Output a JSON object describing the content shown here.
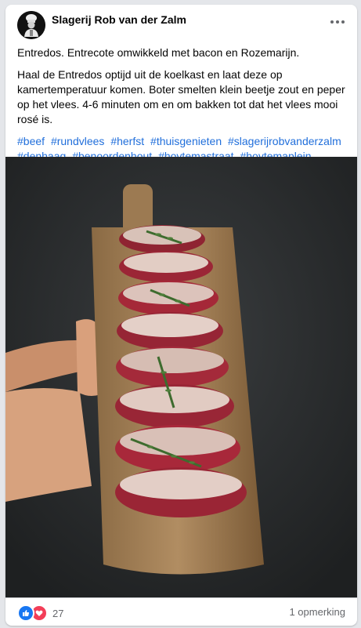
{
  "post": {
    "page_name": "Slagerij Rob van der Zalm",
    "intro": "Entredos. Entrecote omwikkeld met bacon en Rozemarijn.",
    "body": "Haal de Entredos optijd uit de koelkast en laat deze op kamertemperatuur komen. Boter smelten klein beetje zout en peper op het vlees. 4-6 minuten om en om bakken tot dat het vlees mooi rosé is.",
    "hashtags": [
      "#beef",
      "#rundvlees",
      "#herfst",
      "#thuisgenieten",
      "#slagerijrobvanderzalm",
      "#denhaag",
      "#benoordenhout",
      "#hoytemastraat",
      "#hoytemaplein"
    ]
  },
  "footer": {
    "reaction_count": "27",
    "comments_label": "1 opmerking"
  },
  "colors": {
    "link": "#216fdb",
    "like": "#1877f2",
    "love": "#f33e58",
    "muted": "#65676b"
  },
  "icons": {
    "avatar": "chef-logo-icon",
    "more": "more-horizontal-icon",
    "like": "thumbs-up-icon",
    "love": "heart-icon"
  }
}
